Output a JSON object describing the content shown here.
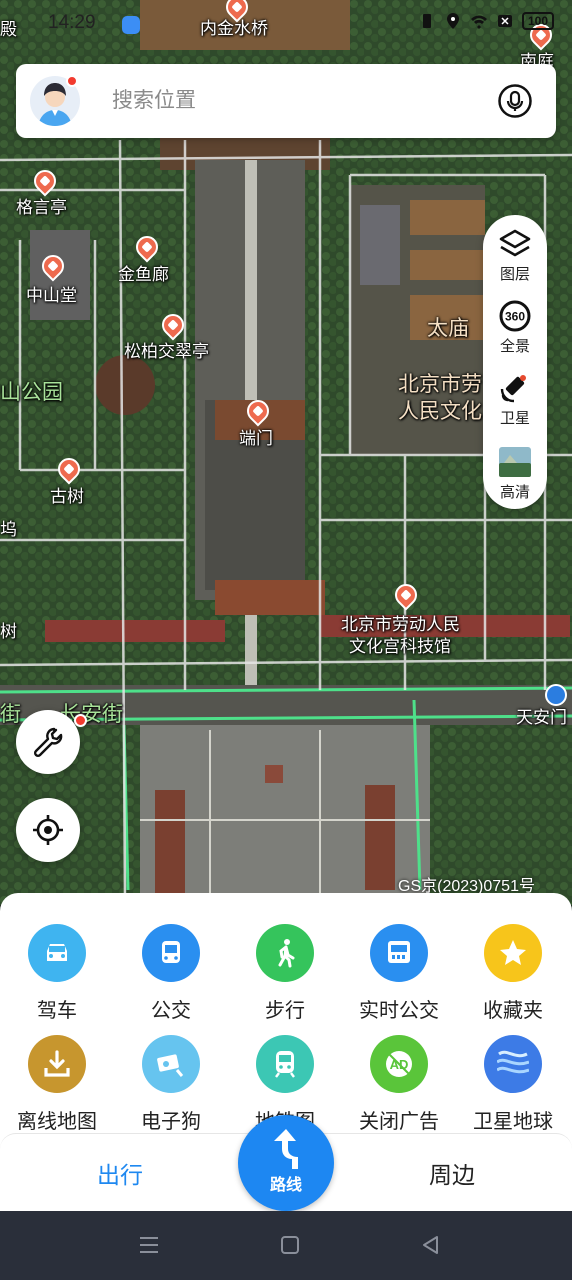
{
  "status_bar": {
    "time": "14:29",
    "battery": "100"
  },
  "search": {
    "placeholder": "搜索位置"
  },
  "map": {
    "labels": {
      "neijinshuiqiao": "内金水桥",
      "nanting": "南庭",
      "geyanting": "格言亭",
      "zhongshantang": "中山堂",
      "jinyulang": "金鱼廊",
      "songbai": "松柏交翠亭",
      "zhongshangongyuan": "山公园",
      "duanmen": "端门",
      "taimiao": "太庙",
      "laodong_culture_1": "北京市劳",
      "laodong_culture_2": "人民文化",
      "gushu": "古树",
      "wu": "坞",
      "shu": "树",
      "dian": "殿",
      "keji_1": "北京市劳动人民",
      "keji_2": "文化宫科技馆",
      "changanjie": "长安街",
      "jie": "街",
      "tiananmen": "天安门"
    },
    "copyright": "GS京(2023)0751号"
  },
  "layer_panel": {
    "items": [
      {
        "label": "图层",
        "icon": "layers-icon"
      },
      {
        "label": "全景",
        "icon": "panorama-360-icon"
      },
      {
        "label": "卫星",
        "icon": "satellite-icon"
      },
      {
        "label": "高清",
        "icon": "hd-thumbnail-icon"
      }
    ]
  },
  "quick_grid": {
    "row1": [
      {
        "label": "驾车",
        "icon": "car-icon",
        "color": "#3fb4f0"
      },
      {
        "label": "公交",
        "icon": "bus-icon",
        "color": "#2a8ff0"
      },
      {
        "label": "步行",
        "icon": "walk-icon",
        "color": "#35c45c"
      },
      {
        "label": "实时公交",
        "icon": "realtime-bus-icon",
        "color": "#2a8ff0"
      },
      {
        "label": "收藏夹",
        "icon": "star-icon",
        "color": "#f7c51b"
      }
    ],
    "row2": [
      {
        "label": "离线地图",
        "icon": "download-icon",
        "color": "#c7962e"
      },
      {
        "label": "电子狗",
        "icon": "camera-icon",
        "color": "#66c4ef"
      },
      {
        "label": "地铁图",
        "icon": "subway-icon",
        "color": "#3cc7b4"
      },
      {
        "label": "关闭广告",
        "icon": "ad-icon",
        "color": "#5ac53a"
      },
      {
        "label": "卫星地球",
        "icon": "globe-icon",
        "color": "#3d7be6"
      }
    ]
  },
  "tabbar": {
    "left": "出行",
    "center": "路线",
    "right": "周边"
  },
  "colors": {
    "accent": "#1d87f2",
    "notification": "#f23b2f"
  }
}
